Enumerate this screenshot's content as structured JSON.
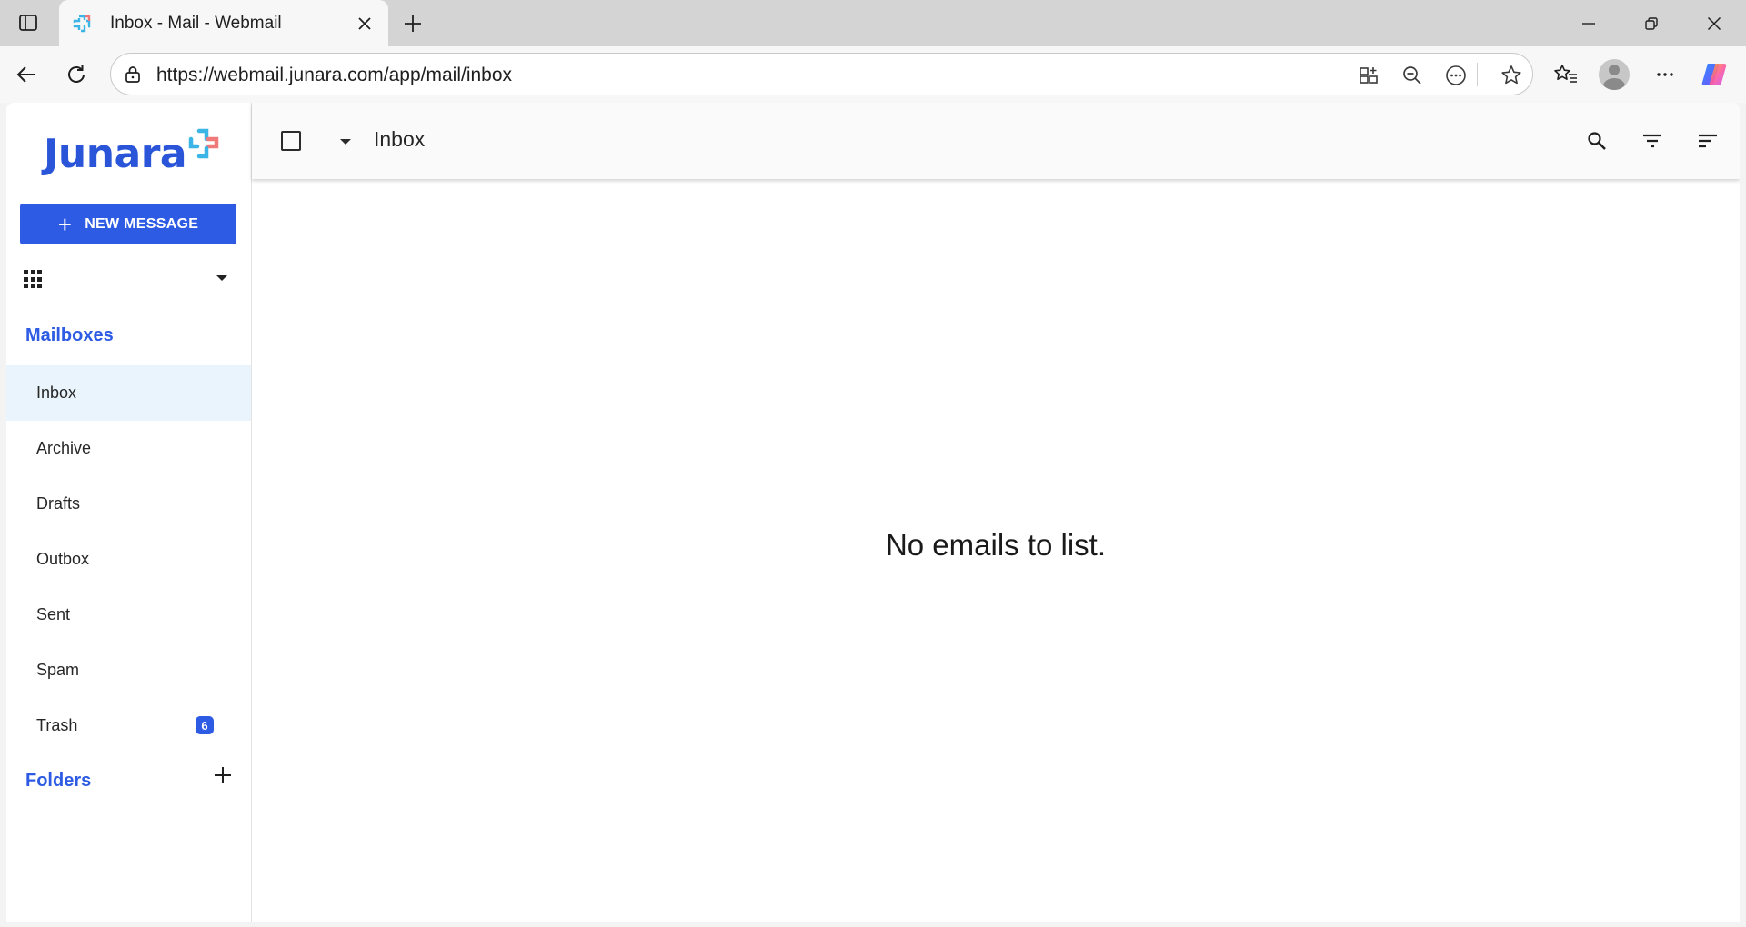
{
  "browser": {
    "tab_title": "Inbox - Mail - Webmail",
    "url": "https://webmail.junara.com/app/mail/inbox",
    "icons": [
      "sidebar-toggle-icon",
      "close-icon",
      "plus-icon",
      "minimize-icon",
      "restore-icon",
      "back-icon",
      "refresh-icon",
      "lock-icon",
      "split-screen-icon",
      "zoom-out-icon",
      "more-icon",
      "star-icon",
      "favorites-icon",
      "profile-icon",
      "copilot-icon"
    ]
  },
  "app": {
    "logo_text": "Junara",
    "brand_color": "#2d5be3",
    "new_message_label": "NEW MESSAGE",
    "mailboxes_title": "Mailboxes",
    "mailboxes": [
      {
        "label": "Inbox",
        "active": true
      },
      {
        "label": "Archive"
      },
      {
        "label": "Drafts"
      },
      {
        "label": "Outbox"
      },
      {
        "label": "Sent"
      },
      {
        "label": "Spam"
      },
      {
        "label": "Trash",
        "badge": "6"
      }
    ],
    "folders_title": "Folders"
  },
  "main": {
    "title": "Inbox",
    "empty_message": "No emails to list."
  }
}
